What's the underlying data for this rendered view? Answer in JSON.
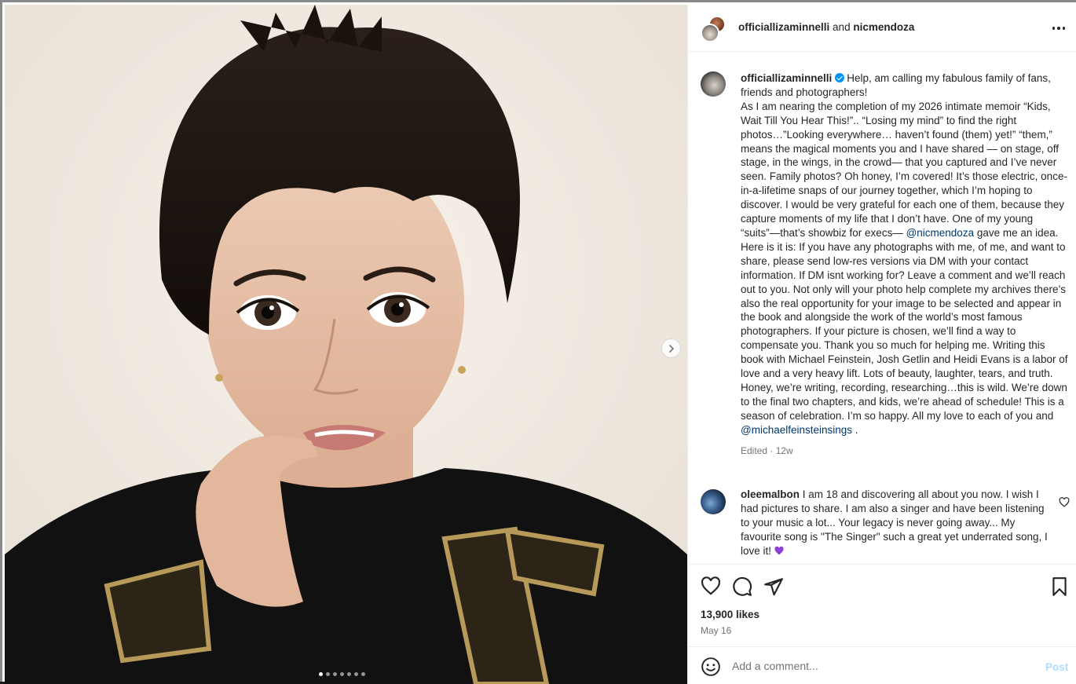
{
  "colors": {
    "accent": "#0095f6",
    "mention": "#00376b",
    "text": "#262626",
    "muted": "#737373",
    "post_disabled": "#b3dbff"
  },
  "media": {
    "slide_count": 7,
    "active_slide": 1,
    "next_icon": "chevron-right-icon"
  },
  "header": {
    "user1": "officiallizaminnelli",
    "joiner": "and",
    "user2": "nicmendoza",
    "more_icon": "more-horizontal-icon"
  },
  "caption": {
    "username": "officiallizaminnelli",
    "verified_icon": "verified-badge-icon",
    "text1": "Help, am calling my fabulous family of fans, friends and photographers!",
    "text2": "As I am nearing the completion of my 2026 intimate memoir “Kids, Wait Till You Hear This!”.. “Losing my mind” to find the right photos…”Looking everywhere… haven’t found (them) yet!” “them,” means the magical moments you and I have shared — on stage, off stage, in the wings, in the crowd— that you captured and I’ve never seen. Family photos? Oh honey, I’m covered! It’s those electric, once-in-a-lifetime snaps of our journey together, which I’m hoping to discover. I would be very grateful for each one of them, because they capture moments of my life that I don’t have. One of my young “suits”—that’s showbiz for execs— ",
    "mention1": "@nicmendoza",
    "text3": " gave me an idea. Here is it is: If you have any photographs with me, of me, and want to share, please send low-res versions via DM with your contact information. If DM isnt working for? Leave a comment and we’ll reach out to you. Not only will your photo help complete my archives there’s also the real opportunity for your image to be selected and appear in the book and alongside the work of the world’s most famous photographers. If your picture is chosen, we’ll find a way to compensate you. Thank you so much for helping me. Writing this book with Michael Feinstein, Josh Getlin and Heidi Evans is a labor of love and a very heavy lift. Lots of beauty, laughter, tears, and truth.",
    "text4": "Honey, we’re writing, recording, researching…this is wild. We’re down to the final two chapters, and kids, we’re ahead of schedule! This is a season of celebration. I’m so happy. All my love to each of you and ",
    "mention2": "@michaelfeinsteinsings",
    "text5": " .",
    "meta": "Edited · 12w"
  },
  "comment": {
    "username": "oleemalbon",
    "text": "I am 18 and discovering all about you now. I wish I had pictures to share. I am also a singer and have been listening to your music a lot... Your legacy is never going away... My favourite song is \"The Singer\" such a great yet underrated song, I love it! ",
    "emoji_icon": "purple-heart-icon",
    "like_icon": "heart-icon"
  },
  "actions": {
    "like_icon": "heart-icon",
    "comment_icon": "comment-icon",
    "share_icon": "send-icon",
    "save_icon": "bookmark-icon"
  },
  "likes": "13,900 likes",
  "date": "May 16",
  "add_comment": {
    "placeholder": "Add a comment...",
    "post_label": "Post",
    "emoji_icon": "emoji-icon"
  }
}
